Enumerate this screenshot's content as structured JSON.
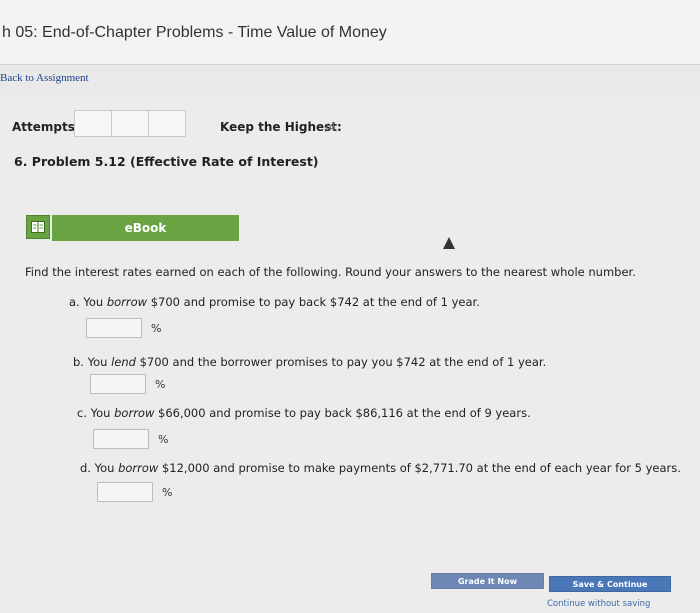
{
  "header": {
    "chapter_title": "h 05: End-of-Chapter Problems - Time Value of Money",
    "back_link": "Back to Assignment"
  },
  "attempts": {
    "label": "Attempts:",
    "keep_label": "Keep the Highest:",
    "keep_value": "/4"
  },
  "problem": {
    "title": "6. Problem 5.12 (Effective Rate of Interest)",
    "ebook_label": "eBook",
    "instructions": "Find the interest rates earned on each of the following. Round your answers to the nearest whole number.",
    "questions": [
      {
        "prefix": "a. You ",
        "em": "borrow",
        "suffix": " $700 and promise to pay back $742 at the end of 1 year.",
        "value": "",
        "unit": "%"
      },
      {
        "prefix": "b. You ",
        "em": "lend",
        "suffix": " $700 and the borrower promises to pay you $742 at the end of 1 year.",
        "value": "",
        "unit": "%"
      },
      {
        "prefix": "c. You ",
        "em": "borrow",
        "suffix": " $66,000 and promise to pay back $86,116 at the end of 9 years.",
        "value": "",
        "unit": "%"
      },
      {
        "prefix": "d. You ",
        "em": "borrow",
        "suffix": " $12,000 and promise to make payments of $2,771.70 at the end of each year for 5 years.",
        "value": "",
        "unit": "%"
      }
    ]
  },
  "footer": {
    "grade_label": "Grade It Now",
    "save_label": "Save & Continue",
    "continue_label": "Continue without saving"
  },
  "colors": {
    "ebook_green": "#6aa341",
    "grade_blue": "#6d88b4",
    "save_blue": "#4a77b8",
    "link_blue": "#1d3f8f"
  },
  "icons": {
    "ebook": "book-icon",
    "cursor": "mouse-cursor-icon"
  }
}
